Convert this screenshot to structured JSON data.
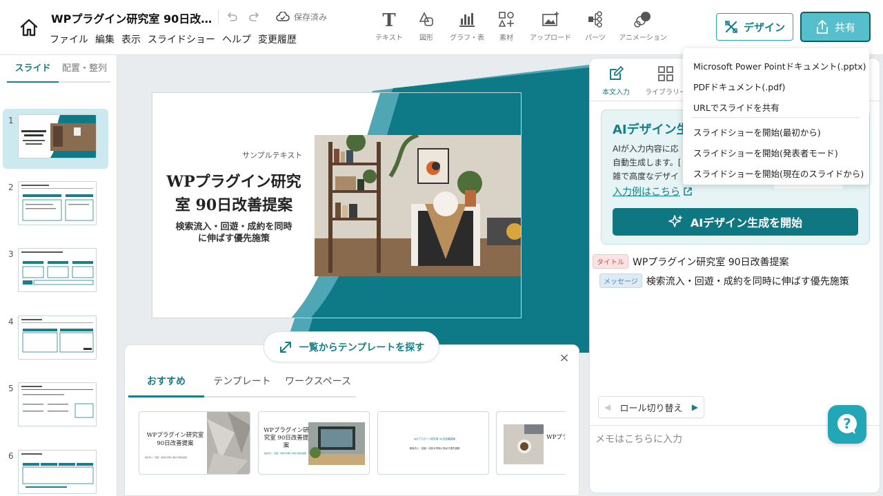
{
  "header": {
    "title": "WPプラグイン研究室 90日改…",
    "saved_label": "保存済み",
    "menu": [
      "ファイル",
      "編集",
      "表示",
      "スライドショー",
      "ヘルプ",
      "変更履歴"
    ],
    "tools": [
      {
        "label": "テキスト",
        "icon": "text-icon"
      },
      {
        "label": "図形",
        "icon": "shapes-icon"
      },
      {
        "label": "グラフ・表",
        "icon": "chart-icon"
      },
      {
        "label": "素材",
        "icon": "elements-icon"
      },
      {
        "label": "アップロード",
        "icon": "upload-image-icon"
      },
      {
        "label": "パーツ",
        "icon": "parts-icon"
      },
      {
        "label": "アニメーション",
        "icon": "animation-icon"
      }
    ],
    "design_label": "デザイン",
    "share_label": "共有"
  },
  "left_panel": {
    "tabs": [
      "スライド",
      "配置・整列"
    ],
    "active_tab": 0,
    "slides": [
      "1",
      "2",
      "3",
      "4",
      "5",
      "6"
    ],
    "selected_slide": 0
  },
  "slide": {
    "sample_text": "サンプルテキスト",
    "title_line1": "WPプラグイン研究",
    "title_line2": "室 90日改善提案",
    "subtitle_line1": "検索流入・回遊・成約を同時",
    "subtitle_line2": "に伸ばす優先施策"
  },
  "template_panel": {
    "find_label": "一覧からテンプレートを探す",
    "close": "×",
    "tabs": [
      "おすすめ",
      "テンプレート",
      "ワークスペース"
    ],
    "active_tab": 0,
    "cards": [
      {
        "title": "WPプラグイン研究室 90日改善提案",
        "sub": "検索流入・回遊・成約を同時に伸ばす優先施策"
      },
      {
        "title": "WPプラグイン研究室 90日改善提案",
        "sub": "検索流入・回遊・成約を同時に伸ばす優先施策"
      },
      {
        "title": "WPプラグイン研究室 90日改善提案",
        "sub": "検索流入・回遊・成約を同時に伸ばす優先施策"
      },
      {
        "title": "WPプラ",
        "sub": ""
      }
    ]
  },
  "right_panel": {
    "tabs": [
      {
        "label": "本文入力",
        "icon": "edit-icon"
      },
      {
        "label": "ライブラリー",
        "icon": "library-grid-icon"
      }
    ],
    "ai": {
      "title": "AIデザイン生",
      "desc_line1": "AIが入力内容に応",
      "desc_line2": "自動生成します。[",
      "desc_line3": "雑で高度なデザイ",
      "link": "入力例はこちら",
      "button": "AIデザイン生成を開始"
    },
    "roles": [
      {
        "tag": "タイトル",
        "text": "WPプラグイン研究室 90日改善提案"
      },
      {
        "tag": "メッセージ",
        "text": "検索流入・回遊・成約を同時に伸ばす優先施策"
      }
    ],
    "role_switch": "ロール切り替え",
    "memo_placeholder": "メモはこちらに入力"
  },
  "share_menu": {
    "items": [
      "Microsoft Power Pointドキュメント(.pptx)",
      "PDFドキュメント(.pdf)",
      "URLでスライドを共有",
      "スライドショーを開始(最初から)",
      "スライドショーを開始(発表者モード)",
      "スライドショーを開始(現在のスライドから)"
    ]
  },
  "colors": {
    "accent": "#157f88",
    "accent_dark": "#0f7782",
    "teal_shape": "#0e7a88",
    "teal_light": "#4fa6b4"
  }
}
